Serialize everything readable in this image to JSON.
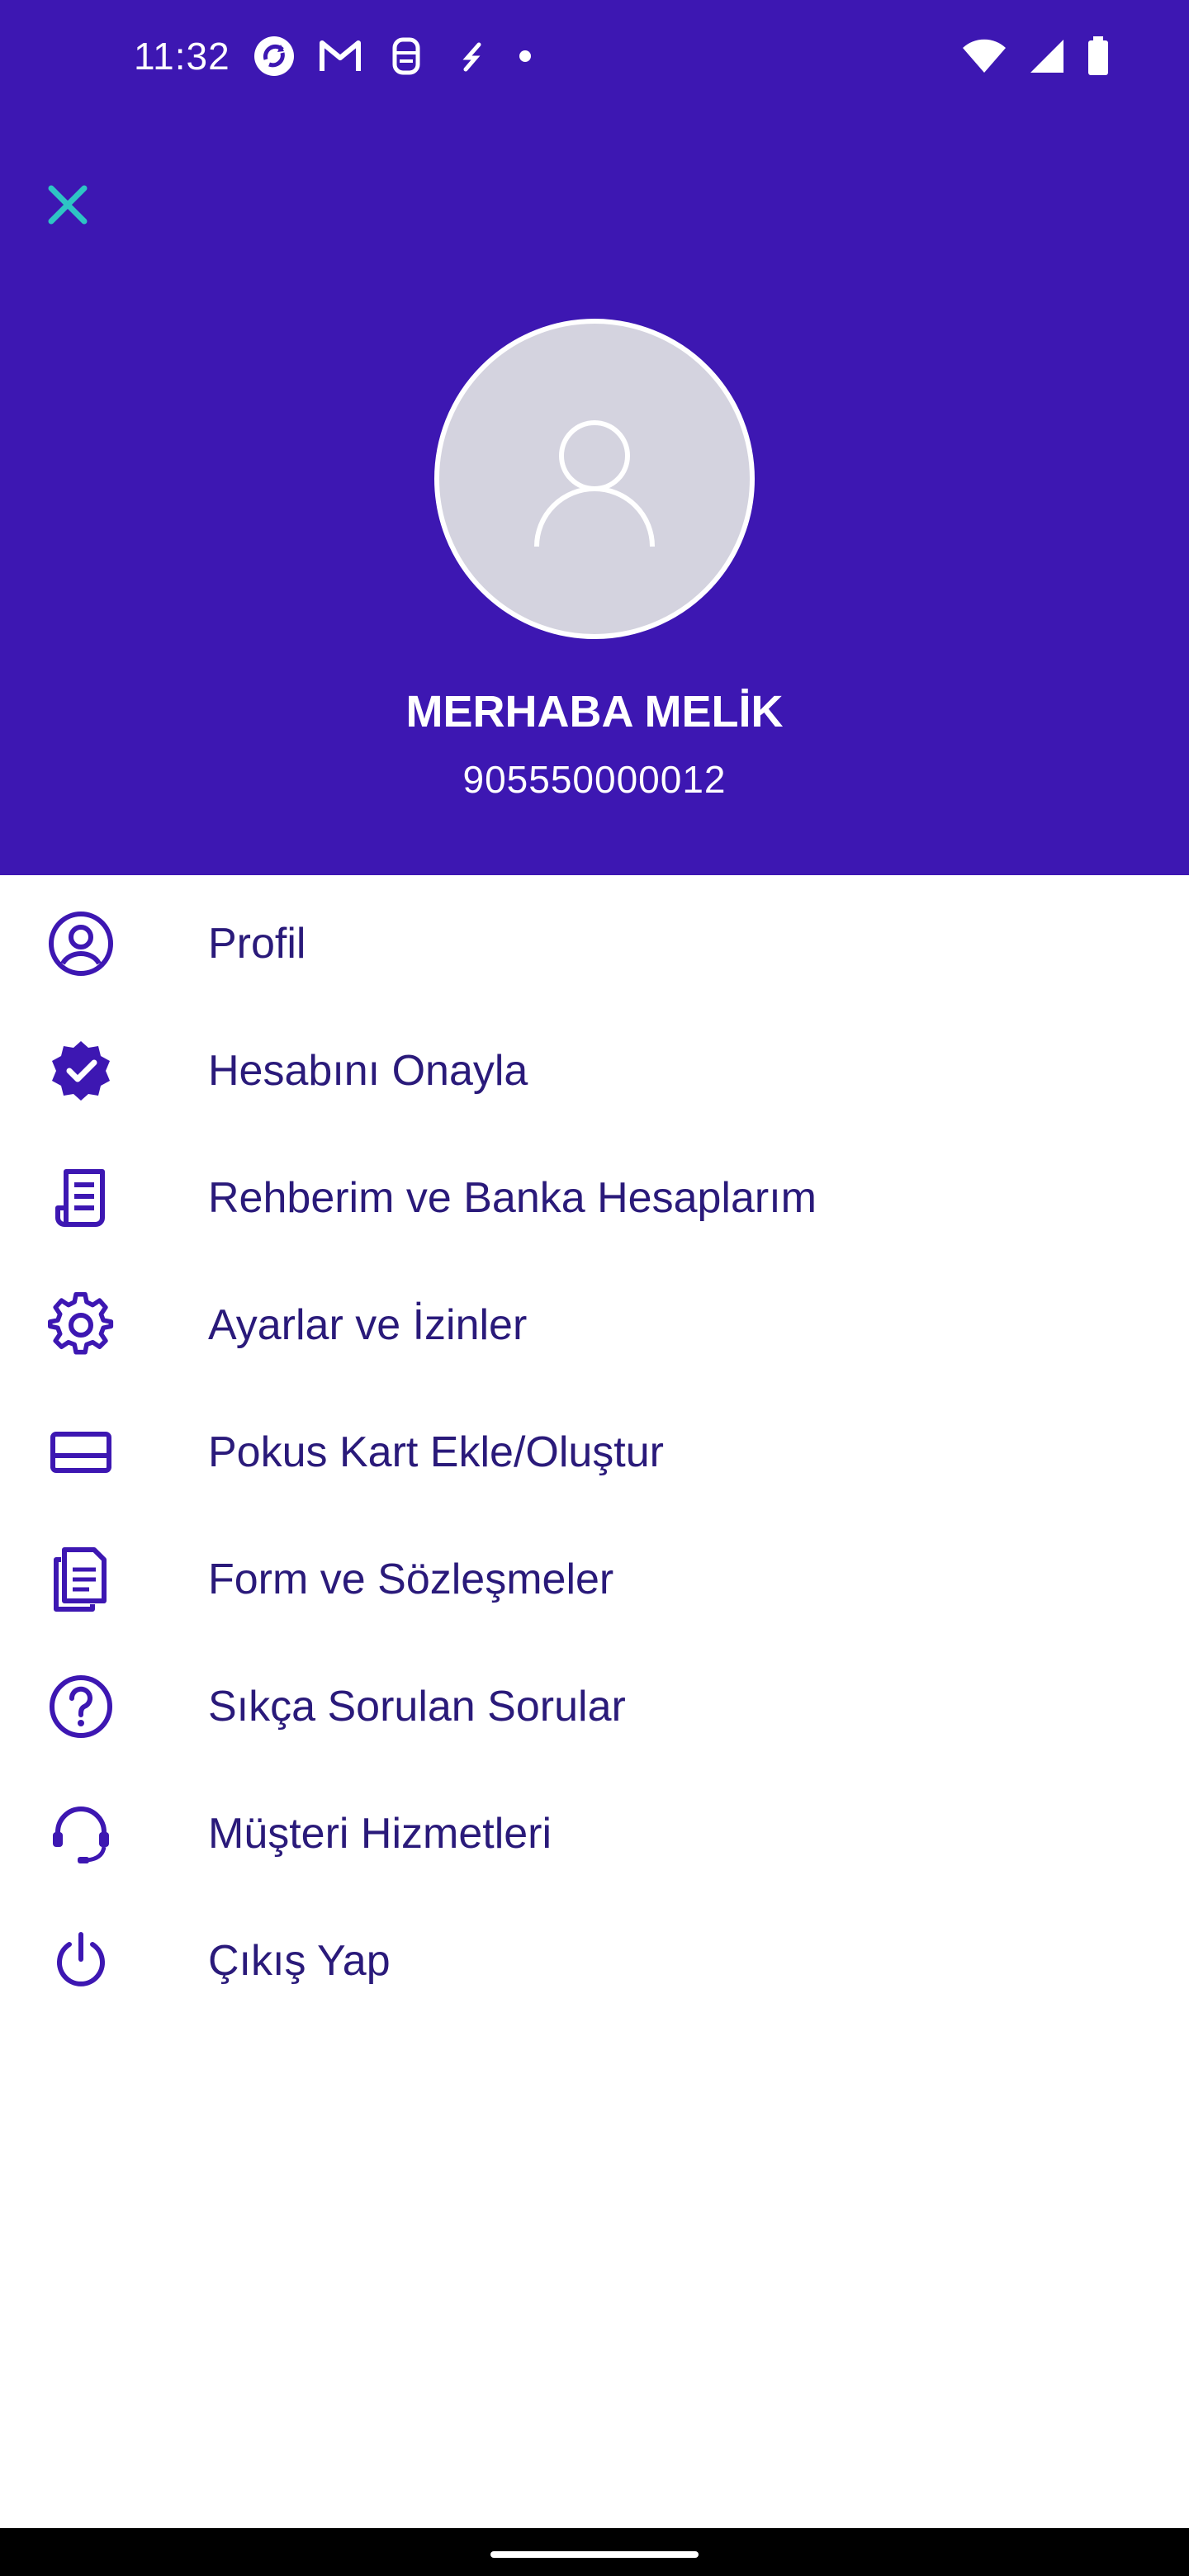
{
  "status_bar": {
    "time": "11:32"
  },
  "header": {
    "greeting": "MERHABA MELİK",
    "phone": "905550000012"
  },
  "menu": {
    "items": [
      {
        "label": "Profil",
        "icon": "user-circle-icon"
      },
      {
        "label": "Hesabını Onayla",
        "icon": "verified-badge-icon"
      },
      {
        "label": "Rehberim ve Banka Hesaplarım",
        "icon": "receipt-icon"
      },
      {
        "label": "Ayarlar ve İzinler",
        "icon": "gear-icon"
      },
      {
        "label": "Pokus Kart Ekle/Oluştur",
        "icon": "credit-card-icon"
      },
      {
        "label": "Form ve Sözleşmeler",
        "icon": "documents-icon"
      },
      {
        "label": "Sıkça Sorulan Sorular",
        "icon": "help-circle-icon"
      },
      {
        "label": "Müşteri Hizmetleri",
        "icon": "headset-icon"
      },
      {
        "label": "Çıkış Yap",
        "icon": "power-icon"
      }
    ]
  },
  "colors": {
    "header_bg": "#3d17b2",
    "accent_teal": "#2ec4c4",
    "menu_text": "#2a1a7a",
    "icon_color": "#3d17b2"
  }
}
